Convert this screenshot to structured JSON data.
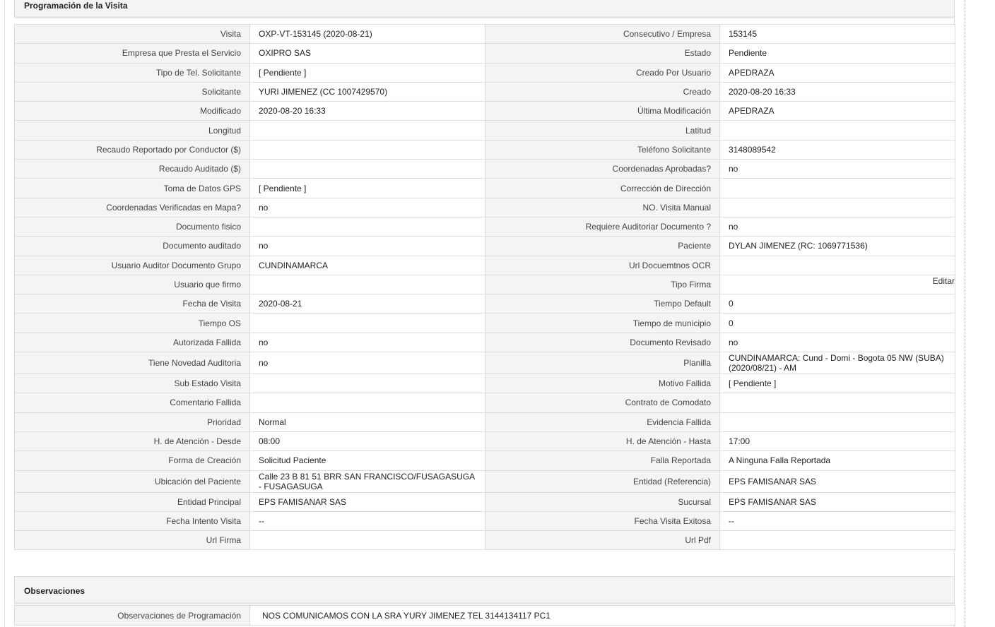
{
  "sections": {
    "programacion_title": "Programación de la Visita",
    "observaciones_title": "Observaciones"
  },
  "rows": [
    {
      "l1": "Visita",
      "v1": "OXP-VT-153145 (2020-08-21)",
      "l2": "Consecutivo / Empresa",
      "v2": "153145"
    },
    {
      "l1": "Empresa que Presta el Servicio",
      "v1": "OXIPRO SAS",
      "l2": "Estado",
      "v2": "Pendiente"
    },
    {
      "l1": "Tipo de Tel. Solicitante",
      "v1": "[ Pendiente ]",
      "l2": "Creado Por Usuario",
      "v2": "APEDRAZA"
    },
    {
      "l1": "Solicitante",
      "v1": "YURI JIMENEZ (CC 1007429570)",
      "l2": "Creado",
      "v2": "2020-08-20 16:33"
    },
    {
      "l1": "Modificado",
      "v1": "2020-08-20 16:33",
      "l2": "Última Modificación",
      "v2": " APEDRAZA"
    },
    {
      "l1": "Longitud",
      "v1": "",
      "l2": "Latitud",
      "v2": ""
    },
    {
      "l1": "Recaudo Reportado por Conductor ($)",
      "v1": "",
      "l2": "Teléfono Solicitante",
      "v2": "3148089542"
    },
    {
      "l1": "Recaudo Auditado ($)",
      "v1": "",
      "l2": "Coordenadas Aprobadas?",
      "v2": " no"
    },
    {
      "l1": "Toma de Datos GPS",
      "v1": "[ Pendiente ]",
      "l2": "Corrección de Dirección",
      "v2": ""
    },
    {
      "l1": "Coordenadas Verificadas en Mapa?",
      "v1": " no",
      "l2": "NO. Visita Manual",
      "v2": ""
    },
    {
      "l1": "Documento fisico",
      "v1": "",
      "l2": "Requiere Auditoriar Documento ?",
      "v2": " no"
    },
    {
      "l1": "Documento auditado",
      "v1": " no",
      "l2": "Paciente",
      "v2": "DYLAN JIMENEZ (RC: 1069771536)"
    },
    {
      "l1": "Usuario Auditor Documento Grupo",
      "v1": "CUNDINAMARCA",
      "l2": "Url Docuemtnos OCR",
      "v2": ""
    },
    {
      "l1": "Usuario que firmo",
      "v1": "",
      "l2": "Tipo Firma",
      "v2": ""
    },
    {
      "l1": "Fecha de Visita",
      "v1": " 2020-08-21",
      "l2": "Tiempo Default",
      "v2": "0"
    },
    {
      "l1": "Tiempo OS",
      "v1": "",
      "l2": "Tiempo de municipio",
      "v2": "0"
    },
    {
      "l1": "Autorizada Fallida",
      "v1": " no",
      "l2": "Documento Revisado",
      "v2": " no"
    },
    {
      "l1": "Tiene Novedad Auditoria",
      "v1": " no",
      "l2": "Planilla",
      "v2": "CUNDINAMARCA: Cund - Domi - Bogota 05 NW (SUBA) (2020/08/21) - AM"
    },
    {
      "l1": "Sub Estado Visita",
      "v1": "",
      "l2": "Motivo Fallida",
      "v2": "[ Pendiente ]"
    },
    {
      "l1": "Comentario Fallida",
      "v1": "",
      "l2": "Contrato de Comodato",
      "v2": ""
    },
    {
      "l1": "Prioridad",
      "v1": "Normal",
      "l2": "Evidencia Fallida",
      "v2": ""
    },
    {
      "l1": "H. de Atención - Desde",
      "v1": "08:00",
      "l2": "H. de Atención - Hasta",
      "v2": "17:00"
    },
    {
      "l1": "Forma de Creación",
      "v1": "Solicitud Paciente",
      "l2": "Falla Reportada",
      "v2": "A Ninguna Falla Reportada"
    },
    {
      "l1": "Ubicación del Paciente",
      "v1": "Calle 23 B 81 51 BRR SAN FRANCISCO/FUSAGASUGA - FUSAGASUGA",
      "l2": "Entidad (Referencia)",
      "v2": "EPS FAMISANAR SAS"
    },
    {
      "l1": "Entidad Principal",
      "v1": "EPS FAMISANAR SAS",
      "l2": "Sucursal",
      "v2": "EPS FAMISANAR SAS"
    },
    {
      "l1": "Fecha Intento Visita",
      "v1": " --",
      "l2": "Fecha Visita Exitosa",
      "v2": " --"
    },
    {
      "l1": "Url Firma",
      "v1": "",
      "l2": "Url Pdf",
      "v2": ""
    }
  ],
  "edit_label": "Editar",
  "observaciones": {
    "label": "Observaciones de Programación",
    "value": "NOS COMUNICAMOS CON LA SRA YURY JIMENEZ TEL 3144134117 PC1"
  }
}
